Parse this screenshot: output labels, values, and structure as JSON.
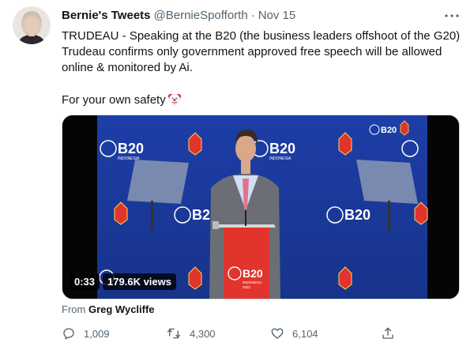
{
  "tweet": {
    "display_name": "Bernie's Tweets",
    "handle": "@BernieSpofforth",
    "separator": "·",
    "date": "Nov 15",
    "text_line1": "TRUDEAU - Speaking at the B20 (the business leaders offshoot of the G20)",
    "text_line2": "Trudeau confirms only government approved free speech will be allowed",
    "text_line3": "online & monitored by Ai.",
    "text_line4": "For your own safety",
    "text_emoji": "clown-face-emoji"
  },
  "video": {
    "duration": "0:33",
    "views": "179.6K views",
    "from_label": "From",
    "from_author": "Greg Wycliffe",
    "backdrop_brand": "B20",
    "backdrop_country": "INDONESIA",
    "backdrop_year": "2022"
  },
  "actions": {
    "replies": "1,009",
    "retweets": "4,300",
    "likes": "6,104"
  },
  "colors": {
    "text_primary": "#0f1419",
    "text_secondary": "#536471",
    "backdrop_blue": "#1a3a9c",
    "podium_red": "#e0342c"
  },
  "icons": [
    "avatar",
    "more-icon",
    "reply-icon",
    "retweet-icon",
    "like-icon",
    "share-icon",
    "clown-face-emoji"
  ]
}
